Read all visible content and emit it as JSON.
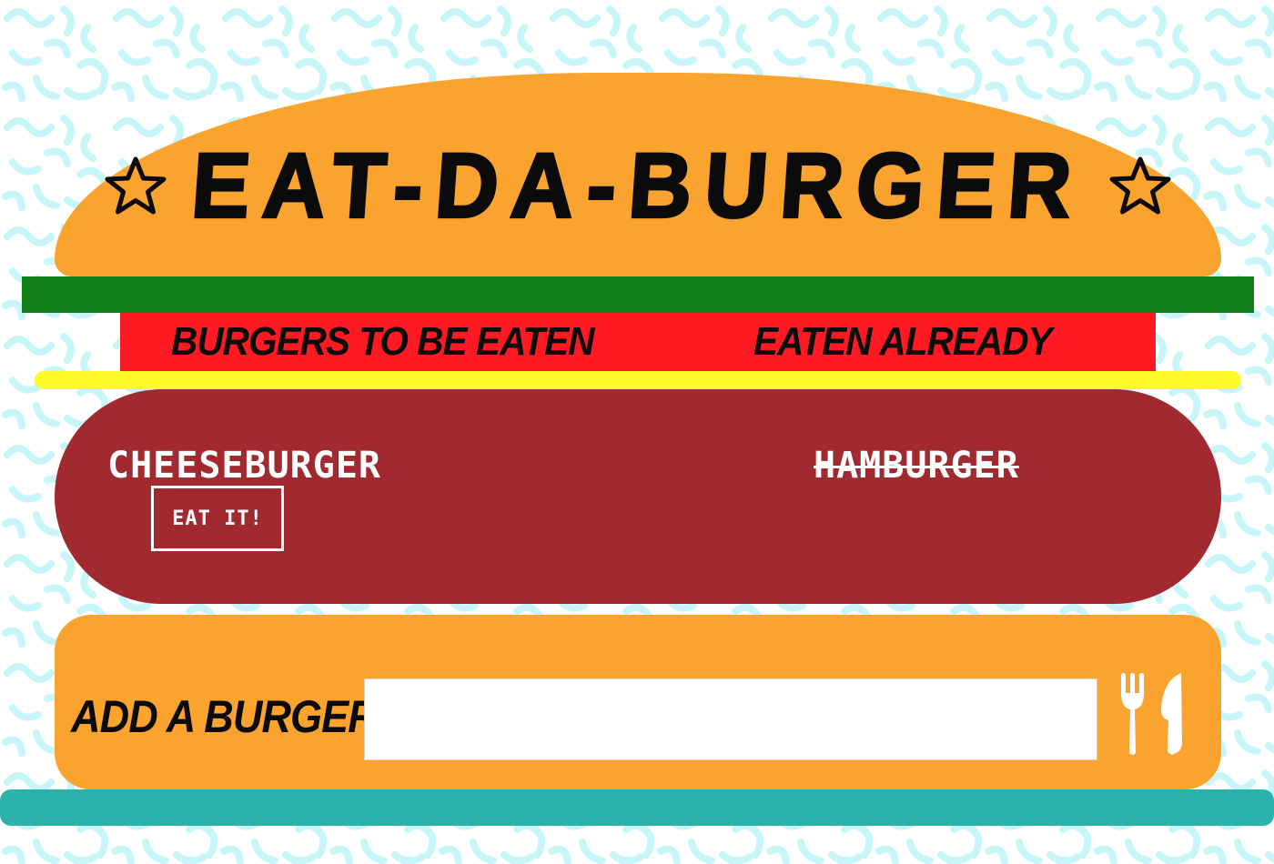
{
  "header": {
    "title": "EAT-DA-BURGER",
    "left_icon": "star-icon",
    "right_icon": "star-icon"
  },
  "columns": {
    "uneaten_heading": "BURGERS TO BE EATEN",
    "eaten_heading": "EATEN ALREADY"
  },
  "burgers": {
    "uneaten": [
      {
        "name": "CHEESEBURGER",
        "button_label": "EAT IT!"
      }
    ],
    "eaten": [
      {
        "name": "HAMBURGER"
      }
    ]
  },
  "add_form": {
    "label": "ADD A BURGER:",
    "input_value": "",
    "submit_icon": "utensils-icon"
  },
  "colors": {
    "bun": "#fba32f",
    "lettuce": "#0f7f17",
    "tomato": "#ff1a23",
    "cheese": "#fffb2a",
    "patty": "#a12a30",
    "plate": "#2bb3ab",
    "pattern": "#c8f6f8"
  }
}
